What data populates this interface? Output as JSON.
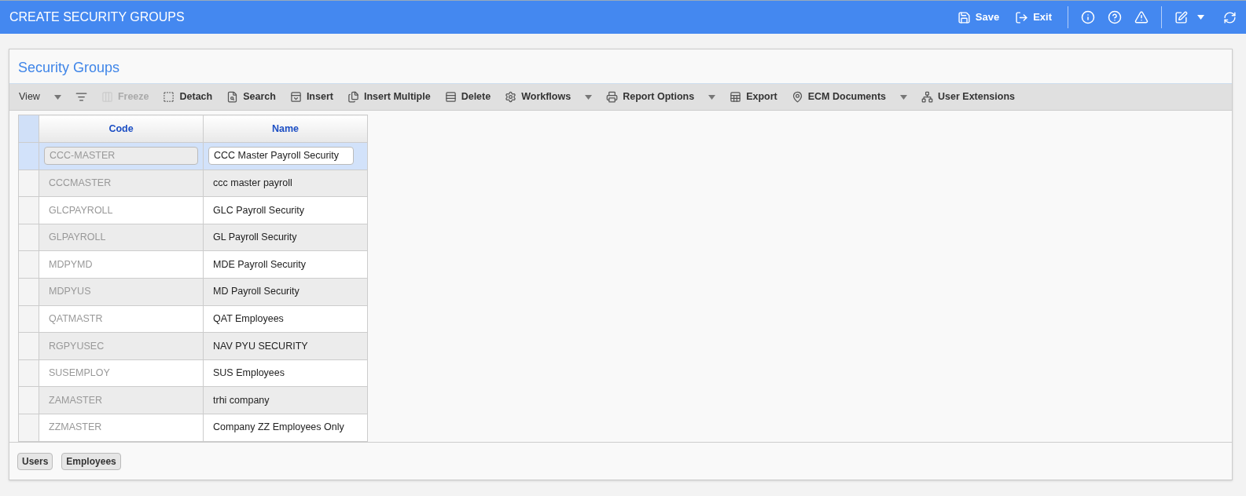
{
  "header": {
    "title": "CREATE SECURITY GROUPS",
    "actions": [
      {
        "label": "Save"
      },
      {
        "label": "Exit"
      }
    ]
  },
  "panel": {
    "title": "Security Groups",
    "toolbar": [
      {
        "label": "View",
        "disabled": false,
        "has_menu": true
      },
      {
        "disabled": false,
        "has_menu": false
      },
      {
        "label": "Freeze",
        "disabled": true,
        "has_menu": false
      },
      {
        "label": "Detach",
        "disabled": false,
        "has_menu": false
      },
      {
        "label": "Search",
        "disabled": false,
        "has_menu": false
      },
      {
        "label": "Insert",
        "disabled": false,
        "has_menu": false
      },
      {
        "label": "Insert Multiple",
        "disabled": false,
        "has_menu": false
      },
      {
        "label": "Delete",
        "disabled": false,
        "has_menu": false
      },
      {
        "label": "Workflows",
        "disabled": false,
        "has_menu": true
      },
      {
        "label": "Report Options",
        "disabled": false,
        "has_menu": true
      },
      {
        "label": "Export",
        "disabled": false,
        "has_menu": false
      },
      {
        "label": "ECM Documents",
        "disabled": false,
        "has_menu": true
      },
      {
        "label": "User Extensions",
        "disabled": false,
        "has_menu": false
      }
    ],
    "table": {
      "columns": [
        "Code",
        "Name"
      ],
      "rows": [
        {
          "code": "CCC-MASTER",
          "name": "CCC Master Payroll Security",
          "selected": true
        },
        {
          "code": "CCCMASTER",
          "name": "ccc master payroll",
          "selected": false
        },
        {
          "code": "GLCPAYROLL",
          "name": "GLC Payroll Security",
          "selected": false
        },
        {
          "code": "GLPAYROLL",
          "name": "GL Payroll Security",
          "selected": false
        },
        {
          "code": "MDPYMD",
          "name": "MDE Payroll Security",
          "selected": false
        },
        {
          "code": "MDPYUS",
          "name": "MD Payroll Security",
          "selected": false
        },
        {
          "code": "QATMASTR",
          "name": "QAT Employees",
          "selected": false
        },
        {
          "code": "RGPYUSEC",
          "name": "NAV PYU SECURITY",
          "selected": false
        },
        {
          "code": "SUSEMPLOY",
          "name": "SUS Employees",
          "selected": false
        },
        {
          "code": "ZAMASTER",
          "name": "trhi company",
          "selected": false
        },
        {
          "code": "ZZMASTER",
          "name": "Company ZZ Employees Only",
          "selected": false
        }
      ]
    },
    "buttons": [
      "Users",
      "Employees"
    ]
  }
}
